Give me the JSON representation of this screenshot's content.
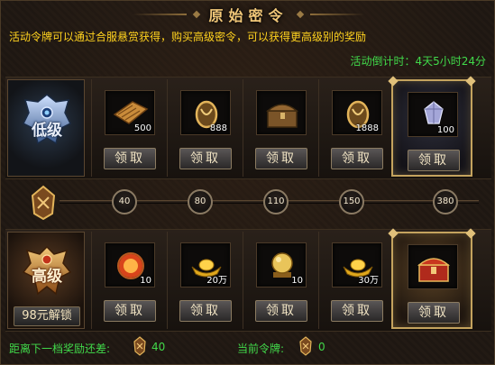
{
  "header": {
    "title": "原始密令",
    "description": "活动令牌可以通过合服悬赏获得，购买高级密令，可以获得更高级别的奖励",
    "countdown_label": "活动倒计时：",
    "countdown_value": "4天5小时24分"
  },
  "low_tier": {
    "label": "低级",
    "rewards": [
      {
        "icon": "scroll-icon",
        "count": "500",
        "claim": "领取"
      },
      {
        "icon": "medal-icon",
        "count": "888",
        "claim": "领取"
      },
      {
        "icon": "chest-icon",
        "count": "",
        "claim": "领取"
      },
      {
        "icon": "medal-icon",
        "count": "1888",
        "claim": "领取"
      },
      {
        "icon": "gem-icon",
        "count": "100",
        "claim": "领取"
      }
    ]
  },
  "high_tier": {
    "label": "高级",
    "unlock_label": "98元解锁",
    "rewards": [
      {
        "icon": "fire-orb-icon",
        "count": "10",
        "claim": "领取"
      },
      {
        "icon": "gold-ingot-icon",
        "count": "20万",
        "claim": "领取"
      },
      {
        "icon": "golden-orb-icon",
        "count": "10",
        "claim": "领取"
      },
      {
        "icon": "gold-ingot-icon",
        "count": "30万",
        "claim": "领取"
      },
      {
        "icon": "red-treasure-chest-icon",
        "count": "",
        "claim": "领取"
      }
    ]
  },
  "track": {
    "thresholds": [
      "40",
      "80",
      "110",
      "150",
      "380"
    ]
  },
  "footer": {
    "next_label": "距离下一档奖励还差:",
    "next_value": "40",
    "current_label": "当前令牌:",
    "current_value": "0"
  },
  "colors": {
    "accent_gold": "#f2c879",
    "desc_yellow": "#ffd21f",
    "status_green": "#41d94a"
  }
}
